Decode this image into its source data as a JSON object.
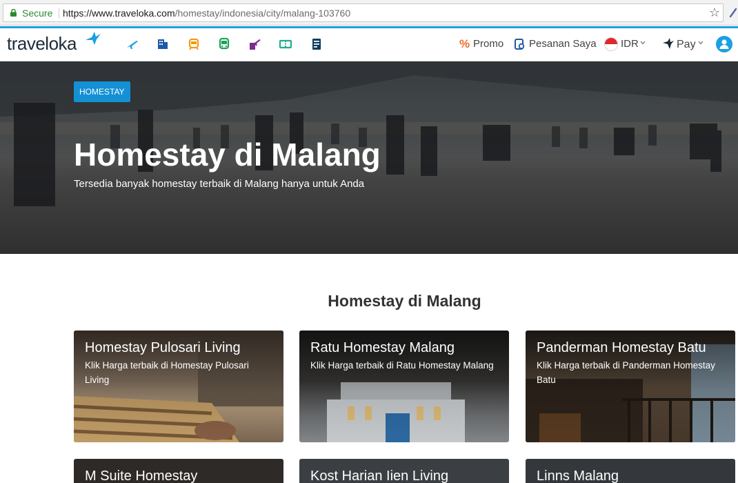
{
  "browser": {
    "secure_label": "Secure",
    "url_host": "https://www.traveloka.com",
    "url_path": "/homestay/indonesia/city/malang-103760"
  },
  "nav": {
    "logo_text": "traveloka",
    "icons": [
      "flight-icon",
      "hotel-icon",
      "train-icon",
      "bus-icon",
      "flight-hotel-icon",
      "xperience-icon",
      "bill-icon"
    ],
    "promo_symbol": "%",
    "promo": "Promo",
    "bookings": "Pesanan Saya",
    "currency": "IDR",
    "pay": "Pay",
    "accent_color": "#1ba0e2"
  },
  "hero": {
    "badge": "HOMESTAY",
    "title": "Homestay di Malang",
    "subtitle": "Tersedia banyak homestay terbaik di Malang hanya untuk Anda"
  },
  "section": {
    "title": "Homestay di Malang"
  },
  "cards": [
    {
      "title": "Homestay Pulosari Living",
      "subtitle": "Klik Harga terbaik di Homestay Pulosari Living"
    },
    {
      "title": "Ratu Homestay Malang",
      "subtitle": "Klik Harga terbaik di Ratu Homestay Malang"
    },
    {
      "title": "Panderman Homestay Batu",
      "subtitle": "Klik Harga terbaik di Panderman Homestay Batu"
    },
    {
      "title": "M Suite Homestay",
      "subtitle": ""
    },
    {
      "title": "Kost Harian Iien Living",
      "subtitle": ""
    },
    {
      "title": "Linns Malang",
      "subtitle": ""
    }
  ]
}
